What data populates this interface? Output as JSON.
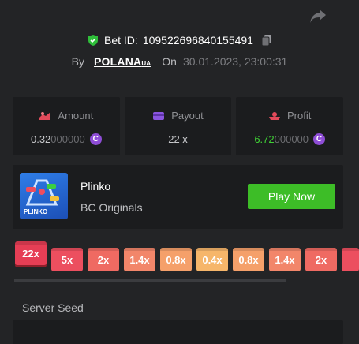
{
  "bet": {
    "label": "Bet ID:",
    "id": "109522696840155491",
    "by_label": "By",
    "username": "POLANA",
    "username_suffix": "UA",
    "on_label": "On",
    "date": "30.01.2023, 23:00:31"
  },
  "stats": [
    {
      "label": "Amount",
      "value_hi": "0.32",
      "value_lo": "000000"
    },
    {
      "label": "Payout",
      "value": "22 x"
    },
    {
      "label": "Profit",
      "value_hi": "6.72",
      "value_lo": "000000"
    }
  ],
  "coin_symbol": "C",
  "game": {
    "thumb_label": "PLINKO",
    "name": "Plinko",
    "provider": "BC Originals",
    "play_label": "Play Now"
  },
  "multipliers": [
    "22x",
    "5x",
    "2x",
    "1.4x",
    "0.8x",
    "0.4x",
    "0.8x",
    "1.4x",
    "2x",
    ""
  ],
  "seed": {
    "label": "Server Seed"
  },
  "colors": {
    "background": "#232426",
    "panel": "#1b1c1e",
    "accent_green": "#3dbd27",
    "coin_purple": "#8e4dd6",
    "mult_red": "#e63e55",
    "mult_orange": "#f2866a",
    "mult_yellow": "#f6b66a"
  }
}
